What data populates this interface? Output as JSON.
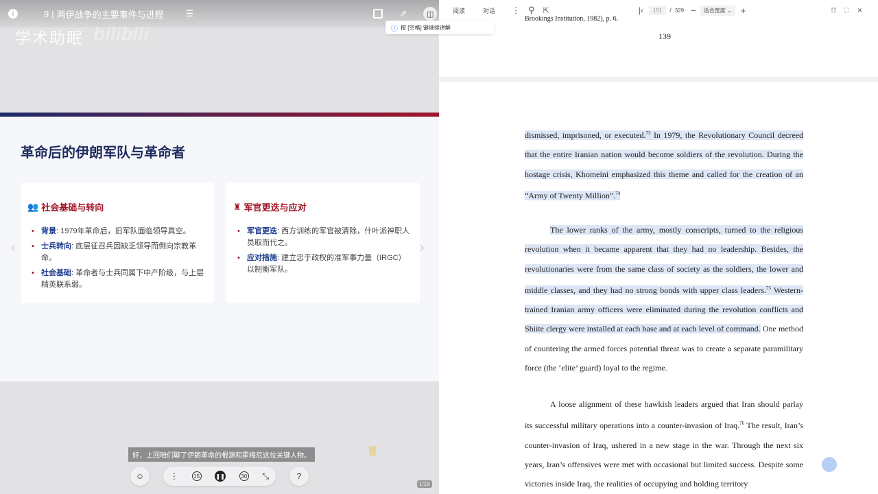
{
  "left": {
    "episode_number": "9",
    "episode_title": "两伊战争的主要事件与进程",
    "watermark": "学术助眠",
    "watermark_logo": "bilibili",
    "tooltip": "按 [空格] 键继续讲解",
    "slide": {
      "title": "革命后的伊朗军队与革命者",
      "cards": [
        {
          "title": "社会基础与转向",
          "items": [
            {
              "term": "背景",
              "text": ": 1979年革命后，旧军队面临领导真空。"
            },
            {
              "term": "士兵转向",
              "text": ": 底层征召兵因缺乏领导而倒向宗教革命。"
            },
            {
              "term": "社会基础",
              "text": ": 革命者与士兵同属下中产阶级，与上层精英联系弱。"
            }
          ]
        },
        {
          "title": "军官更迭与应对",
          "items": [
            {
              "term": "军官更迭",
              "text": ": 西方训练的军官被清除，什叶派神职人员取而代之。"
            },
            {
              "term": "应对措施",
              "text": ": 建立忠于政权的准军事力量（IRGC）以制衡军队。"
            }
          ]
        }
      ]
    },
    "subtitle": "好，上回咱们聊了伊朗革命的根源和霍梅尼这位关键人物。",
    "controls": {
      "rewind": "15",
      "forward": "30"
    },
    "slide_counter": "1/18"
  },
  "right": {
    "toolbar": {
      "read_tab": "阅读",
      "chat_tab": "对话",
      "page_current": "151",
      "page_sep": "/",
      "page_total": "329",
      "zoom_mode": "适合宽度"
    },
    "footnote": "Brookings Institution, 1982), p. 6.",
    "page_number": "139",
    "p1": {
      "a": "dismissed, imprisoned, or executed.",
      "s1": "73",
      "b": " In 1979, the Revolutionary Council decreed that the entire Iranian nation would become soldiers of the revolution.  During the hostage crisis, Khomeini emphasized this theme and called for the creation of an “Army of Twenty Million”.",
      "s2": "74"
    },
    "p2": {
      "a": "The lower ranks of the army, mostly conscripts, turned to the religious revolution when it became apparent that they had no leadership. Besides, the revolutionaries were from the same class of society as the soldiers, the lower and middle classes, and they had no strong bonds with upper class leaders.",
      "s1": "75",
      "b": " Western-trained Iranian army officers were eliminated during the revolution conflicts and Shiite clergy were installed at each base and at each level of command.",
      "c": " One method of countering the armed forces potential threat was to create a separate paramilitary force (the ‘elite’ guard) loyal to the regime."
    },
    "p3": {
      "a": "A loose alignment of these hawkish leaders argued that Iran should parlay its successful military operations into a counter-invasion of Iraq.",
      "s1": "76",
      "b": " The result, Iran’s counter-invasion of Iraq, ushered in a new stage in the war. Through the next six years, Iran’s offensives were met with occasional but limited success. Despite some victories inside Iraq, the realities of occupying and holding territory"
    }
  }
}
